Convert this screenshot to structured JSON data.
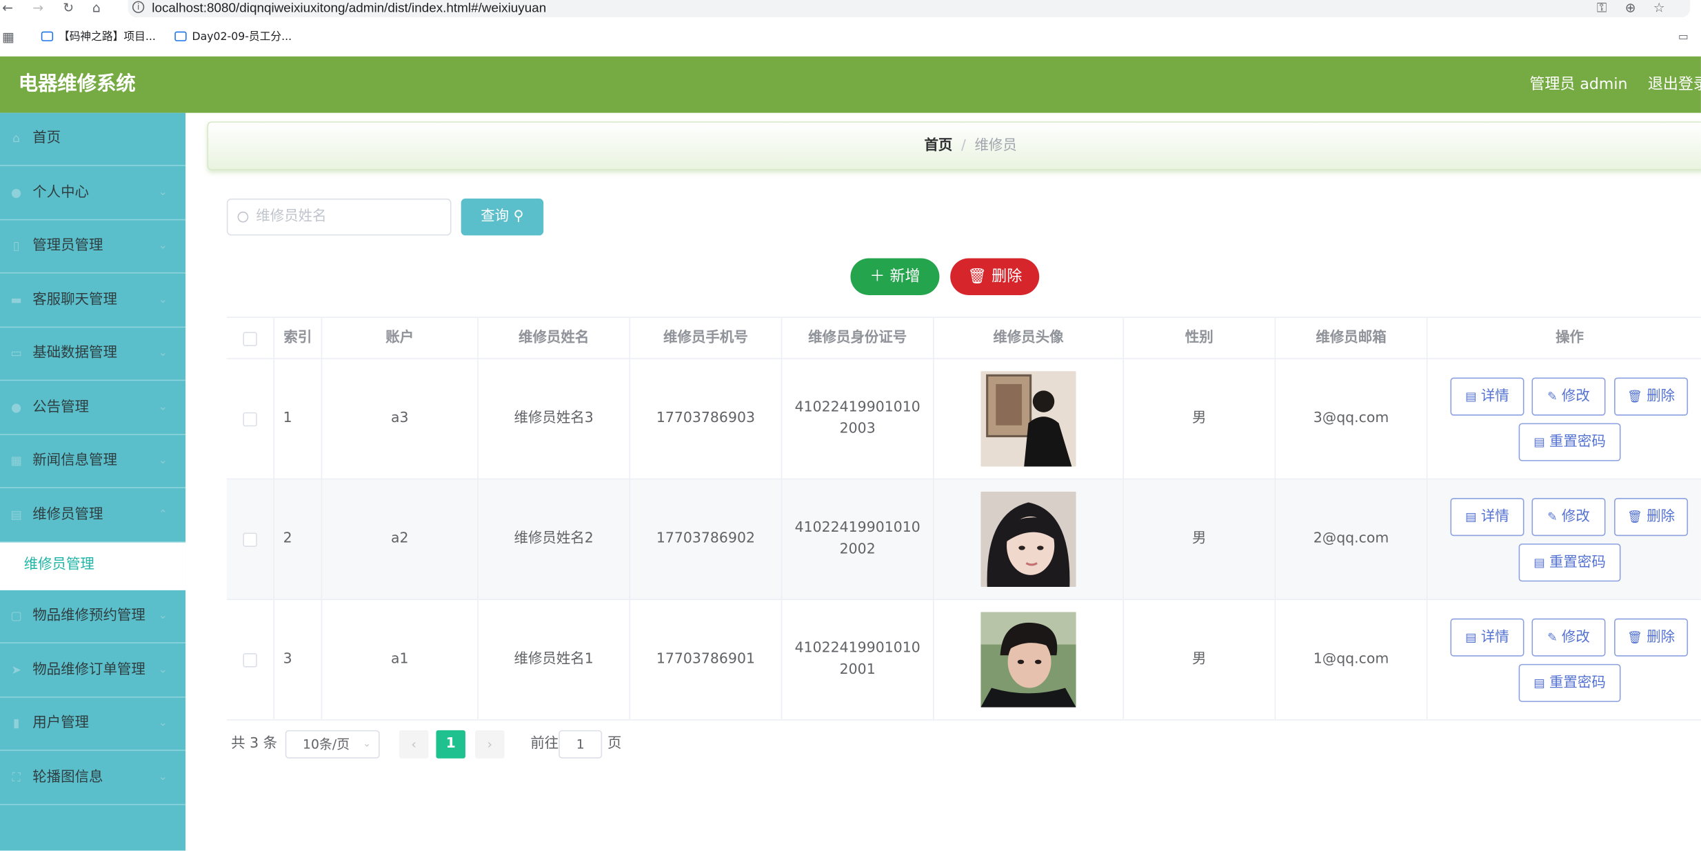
{
  "browser": {
    "url": "localhost:8080/diqnqiweixiuxitong/admin/dist/index.html#/weixiuyuan",
    "bookmarks": [
      "【码神之路】项目...",
      "Day02-09-员工分..."
    ]
  },
  "header": {
    "title": "电器维修系统",
    "user_label": "管理员 admin",
    "logout": "退出登录"
  },
  "sidebar": {
    "items": [
      {
        "label": "首页",
        "icon": "home-icon"
      },
      {
        "label": "个人中心",
        "icon": "user-icon"
      },
      {
        "label": "管理员管理",
        "icon": "phone-icon"
      },
      {
        "label": "客服聊天管理",
        "icon": "briefcase-icon"
      },
      {
        "label": "基础数据管理",
        "icon": "monitor-icon"
      },
      {
        "label": "公告管理",
        "icon": "user-icon"
      },
      {
        "label": "新闻信息管理",
        "icon": "grid-icon"
      },
      {
        "label": "维修员管理",
        "icon": "archive-icon"
      },
      {
        "label": "物品维修预约管理",
        "icon": "chat-icon"
      },
      {
        "label": "物品维修订单管理",
        "icon": "send-icon"
      },
      {
        "label": "用户管理",
        "icon": "chart-icon"
      },
      {
        "label": "轮播图信息",
        "icon": "frame-icon"
      }
    ],
    "active_sub": "维修员管理"
  },
  "breadcrumb": {
    "home": "首页",
    "current": "维修员"
  },
  "search": {
    "placeholder": "维修员姓名",
    "button": "查询"
  },
  "actions": {
    "add": "新增",
    "delete": "删除"
  },
  "table": {
    "headers": [
      "索引",
      "账户",
      "维修员姓名",
      "维修员手机号",
      "维修员身份证号",
      "维修员头像",
      "性别",
      "维修员邮箱",
      "操作"
    ],
    "rows": [
      {
        "index": "1",
        "account": "a3",
        "name": "维修员姓名3",
        "phone": "17703786903",
        "idcard": "410224199010102003",
        "gender": "男",
        "email": "3@qq.com"
      },
      {
        "index": "2",
        "account": "a2",
        "name": "维修员姓名2",
        "phone": "17703786902",
        "idcard": "410224199010102002",
        "gender": "男",
        "email": "2@qq.com"
      },
      {
        "index": "3",
        "account": "a1",
        "name": "维修员姓名1",
        "phone": "17703786901",
        "idcard": "410224199010102001",
        "gender": "男",
        "email": "1@qq.com"
      }
    ],
    "ops": {
      "detail": "详情",
      "edit": "修改",
      "delete": "删除",
      "reset": "重置密码"
    }
  },
  "pagination": {
    "total": "共 3 条",
    "page_size": "10条/页",
    "current": "1",
    "goto_prefix": "前往",
    "goto_value": "1",
    "goto_suffix": "页"
  },
  "colors": {
    "header": "#75ab42",
    "sidebar": "#5bbfcb",
    "add": "#24a44c",
    "delete": "#d6262c",
    "page_active": "#1fc28f"
  }
}
